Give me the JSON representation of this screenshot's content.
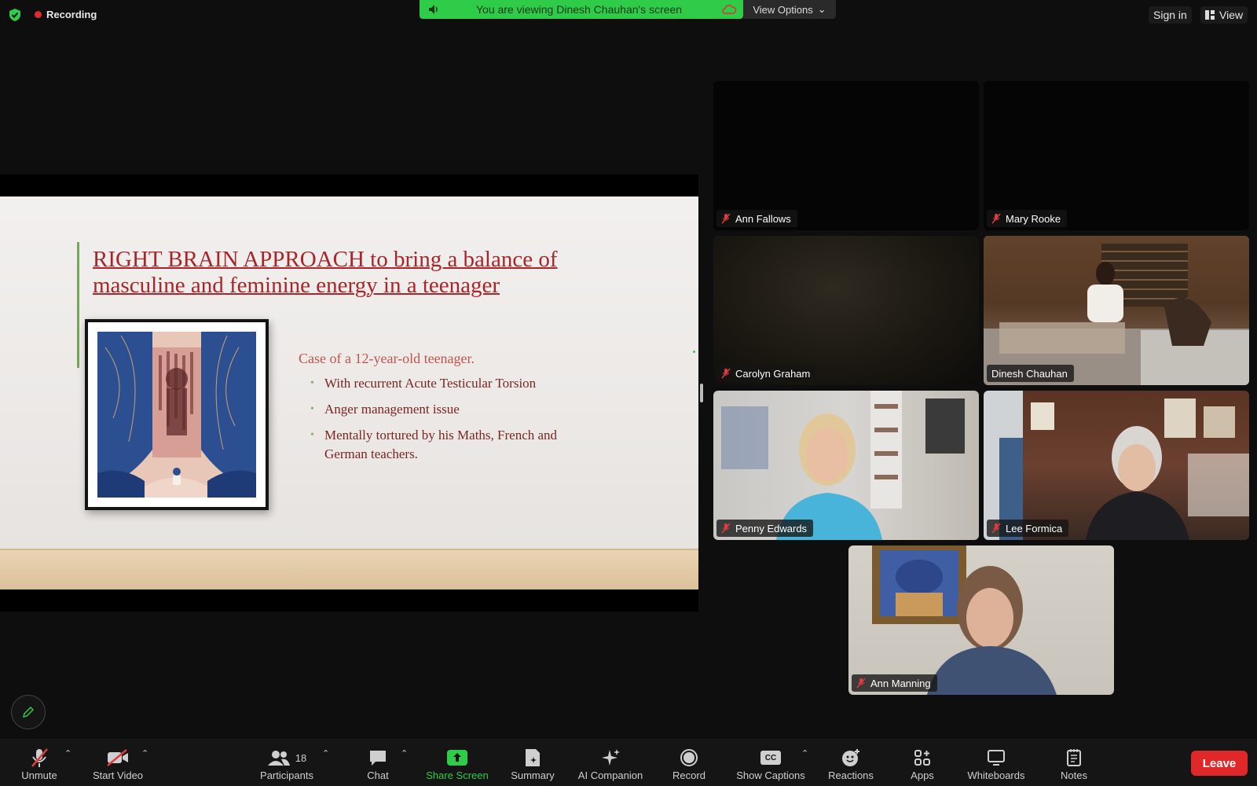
{
  "top": {
    "recording_label": "Recording",
    "viewing_text": "You are viewing Dinesh Chauhan's screen",
    "view_options_label": "View Options",
    "sign_in_label": "Sign in",
    "view_label": "View"
  },
  "slide": {
    "title": "RIGHT BRAIN APPROACH to bring a balance of masculine and feminine energy in a teenager",
    "case_heading": "Case of a 12-year-old teenager.",
    "bullets": [
      "With recurrent Acute Testicular Torsion",
      "Anger management issue",
      "Mentally tortured by his Maths, French and German teachers."
    ]
  },
  "participants": [
    {
      "name": "Ann Fallows",
      "muted": true
    },
    {
      "name": "Mary Rooke",
      "muted": true
    },
    {
      "name": "Carolyn Graham",
      "muted": true
    },
    {
      "name": "Dinesh Chauhan",
      "muted": false,
      "active_speaker": true
    },
    {
      "name": "Penny Edwards",
      "muted": true
    },
    {
      "name": "Lee Formica",
      "muted": true
    },
    {
      "name": "Ann Manning",
      "muted": true
    }
  ],
  "toolbar": {
    "unmute": "Unmute",
    "start_video": "Start Video",
    "participants": "Participants",
    "participants_count": "18",
    "chat": "Chat",
    "share_screen": "Share Screen",
    "summary": "Summary",
    "ai_companion": "AI Companion",
    "record": "Record",
    "show_captions": "Show Captions",
    "captions_badge": "CC",
    "reactions": "Reactions",
    "apps": "Apps",
    "whiteboards": "Whiteboards",
    "notes": "Notes",
    "leave": "Leave"
  },
  "colors": {
    "accent_green": "#2ecc48",
    "leave_red": "#e02828",
    "slide_title": "#a8262a"
  }
}
